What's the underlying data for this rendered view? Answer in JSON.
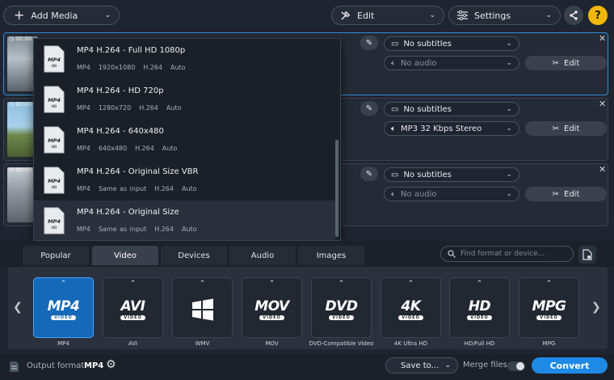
{
  "toolbar": {
    "add_media": "Add Media",
    "edit": "Edit",
    "settings": "Settings"
  },
  "files": [
    {
      "time": "00:00",
      "subtitles": "No subtitles",
      "audio": "No audio",
      "audio_dim": true,
      "edit": "Edit"
    },
    {
      "time": "00:00",
      "subtitles": "No subtitles",
      "audio": "MP3 32 Kbps Stereo",
      "audio_dim": false,
      "edit": "Edit"
    },
    {
      "time": "00:00",
      "subtitles": "No subtitles",
      "audio": "No audio",
      "audio_dim": true,
      "edit": "Edit"
    }
  ],
  "preset_dropdown": {
    "items": [
      {
        "title": "MP4 H.264 - Full HD 1080p",
        "container": "MP4",
        "size": "1920x1080",
        "codec": "H.264",
        "bitrate": "Auto"
      },
      {
        "title": "MP4 H.264 - HD 720p",
        "container": "MP4",
        "size": "1280x720",
        "codec": "H.264",
        "bitrate": "Auto"
      },
      {
        "title": "MP4 H.264 - 640x480",
        "container": "MP4",
        "size": "640x480",
        "codec": "H.264",
        "bitrate": "Auto"
      },
      {
        "title": "MP4 H.264 - Original Size VBR",
        "container": "MP4",
        "size": "Same as input",
        "codec": "H.264",
        "bitrate": "Auto"
      },
      {
        "title": "MP4 H.264 - Original Size",
        "container": "MP4",
        "size": "Same as input",
        "codec": "H.264",
        "bitrate": "Auto"
      }
    ],
    "icon_label": "MP4",
    "icon_sub": "HD"
  },
  "tabs": [
    "Popular",
    "Video",
    "Devices",
    "Audio",
    "Images"
  ],
  "search_placeholder": "Find format or device...",
  "formats": [
    {
      "logo": "MP4",
      "sub": "VIDEO",
      "label": "MP4"
    },
    {
      "logo": "AVI",
      "sub": "VIDEO",
      "label": "AVI"
    },
    {
      "logo": "",
      "sub": "",
      "label": "WMV"
    },
    {
      "logo": "MOV",
      "sub": "VIDEO",
      "label": "MOV"
    },
    {
      "logo": "DVD",
      "sub": "VIDEO",
      "label": "DVD-Compatible Video"
    },
    {
      "logo": "4K",
      "sub": "VIDEO",
      "label": "4K Ultra HD"
    },
    {
      "logo": "HD",
      "sub": "VIDEO",
      "label": "HD/Full HD"
    },
    {
      "logo": "MPG",
      "sub": "VIDEO",
      "label": "MPG"
    }
  ],
  "bottom": {
    "output_label": "Output format:",
    "output_value": "MP4",
    "save_to": "Save to...",
    "merge": "Merge files:",
    "convert": "Convert"
  },
  "colors": {
    "accent": "#1e8ae6",
    "selected_format": "#1569b8"
  },
  "icons": [
    "plus-icon",
    "tools-icon",
    "gear-icon",
    "share-icon",
    "help-icon",
    "subtitle-icon",
    "audio-icon",
    "pen-icon",
    "clock-icon",
    "close-icon",
    "search-icon",
    "file-settings-icon",
    "chevron-left-icon",
    "chevron-right-icon",
    "windows-logo-icon"
  ]
}
